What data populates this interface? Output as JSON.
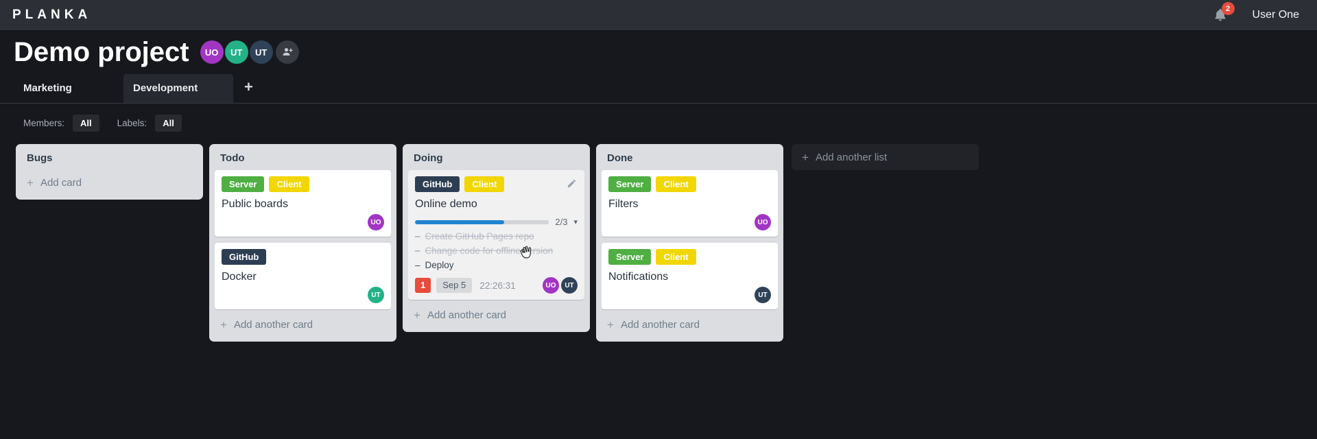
{
  "colors": {
    "topbar_bg": "#2c2f36",
    "page_bg": "#17181d",
    "list_bg": "#dcdde1",
    "progress_fill": "#2084cf",
    "count_badge_bg": "#e74c3c",
    "label_green": "#4faf43",
    "label_yellow": "#f2d600",
    "label_navy": "#2d3e53",
    "avatar_purple": "#a136c3",
    "avatar_teal": "#23b288",
    "avatar_navy": "#2f4257"
  },
  "icons": {
    "plus": "+",
    "chevron_down": "▾"
  },
  "topbar": {
    "logo": "PLANKA",
    "notification_count": "2",
    "user_name": "User One"
  },
  "project": {
    "title": "Demo project",
    "members": [
      {
        "initials": "UO",
        "color": "#a136c3"
      },
      {
        "initials": "UT",
        "color": "#23b288"
      },
      {
        "initials": "UT",
        "color": "#2f4257"
      }
    ]
  },
  "tabs": {
    "items": [
      {
        "label": "Marketing",
        "active": false
      },
      {
        "label": "Development",
        "active": true
      }
    ],
    "add_button": "+"
  },
  "filters": {
    "members_label": "Members:",
    "members_value": "All",
    "labels_label": "Labels:",
    "labels_value": "All"
  },
  "board": {
    "add_list_label": "Add another list",
    "task_bullet": "–",
    "lists": [
      {
        "name": "Bugs",
        "add_label": "Add card",
        "cards": []
      },
      {
        "name": "Todo",
        "add_label": "Add another card",
        "cards": [
          {
            "labels": [
              {
                "text": "Server",
                "color": "#4faf43"
              },
              {
                "text": "Client",
                "color": "#f2d600"
              }
            ],
            "name": "Public boards",
            "members": [
              {
                "initials": "UO",
                "color": "#a136c3"
              }
            ]
          },
          {
            "labels": [
              {
                "text": "GitHub",
                "color": "#2d3e53"
              }
            ],
            "name": "Docker",
            "members": [
              {
                "initials": "UT",
                "color": "#23b288"
              }
            ]
          }
        ]
      },
      {
        "name": "Doing",
        "add_label": "Add another card",
        "cards": [
          {
            "highlighted": true,
            "editable": true,
            "labels": [
              {
                "text": "GitHub",
                "color": "#2d3e53"
              },
              {
                "text": "Client",
                "color": "#f2d600"
              }
            ],
            "name": "Online demo",
            "progress": {
              "percent": 66.7,
              "text": "2/3"
            },
            "tasks": [
              {
                "text": "Create GitHub Pages repo",
                "done": true
              },
              {
                "text": "Change code for offline version",
                "done": true
              },
              {
                "text": "Deploy",
                "done": false
              }
            ],
            "badges": {
              "count": "1",
              "due_date": "Sep 5",
              "timer": "22:26:31"
            },
            "members": [
              {
                "initials": "UO",
                "color": "#a136c3"
              },
              {
                "initials": "UT",
                "color": "#2f4257"
              }
            ]
          }
        ]
      },
      {
        "name": "Done",
        "add_label": "Add another card",
        "cards": [
          {
            "labels": [
              {
                "text": "Server",
                "color": "#4faf43"
              },
              {
                "text": "Client",
                "color": "#f2d600"
              }
            ],
            "name": "Filters",
            "members": [
              {
                "initials": "UO",
                "color": "#a136c3"
              }
            ]
          },
          {
            "labels": [
              {
                "text": "Server",
                "color": "#4faf43"
              },
              {
                "text": "Client",
                "color": "#f2d600"
              }
            ],
            "name": "Notifications",
            "members": [
              {
                "initials": "UT",
                "color": "#2f4257"
              }
            ]
          }
        ]
      }
    ]
  }
}
